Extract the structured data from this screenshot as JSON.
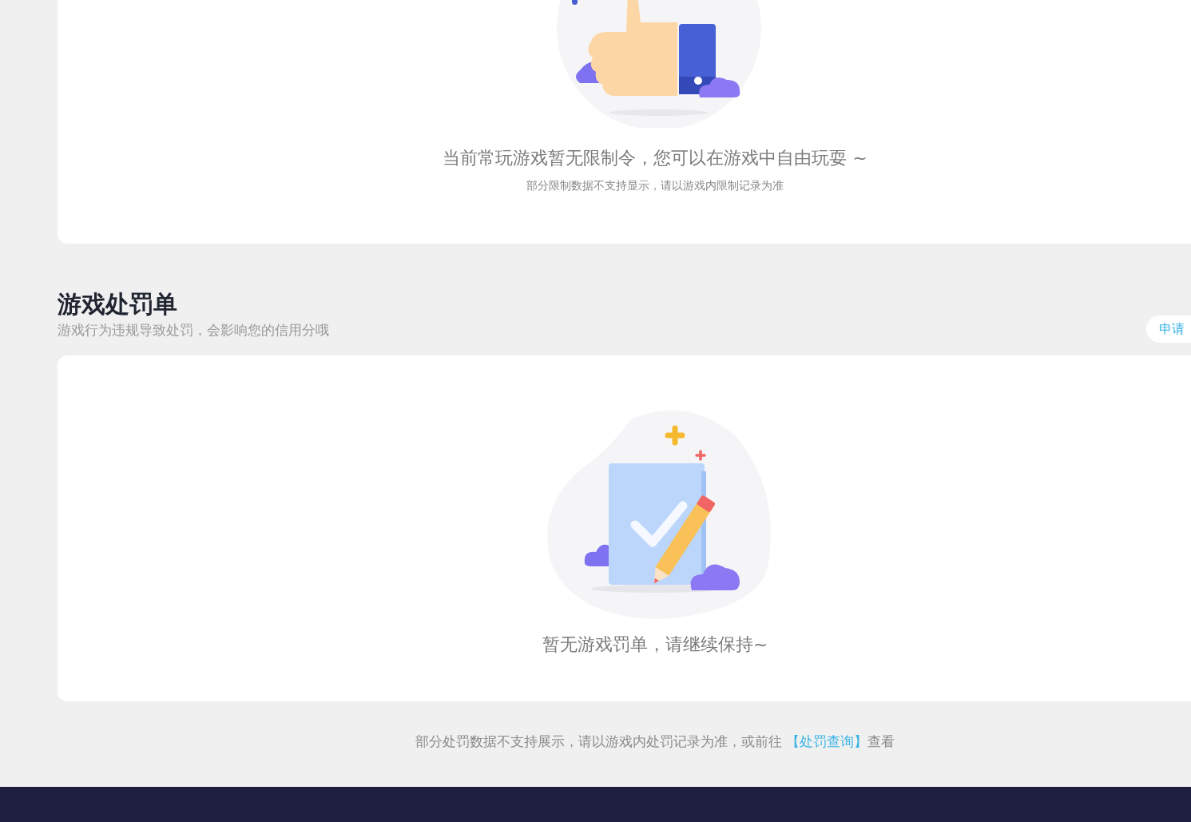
{
  "restriction_card": {
    "message": "当前常玩游戏暂无限制令，您可以在游戏中自由玩耍 ~",
    "note": "部分限制数据不支持显示，请以游戏内限制记录为准"
  },
  "penalty_section": {
    "title": "游戏处罚单",
    "subtitle": "游戏行为违规导致处罚，会影响您的信用分哦",
    "action_button": "申请"
  },
  "penalty_card": {
    "message": "暂无游戏罚单，请继续保持~"
  },
  "footer_note": {
    "parts": [
      {
        "kind": "text",
        "text": "部分处罚数据不支持展示，请以游戏内处罚记录为准，或前往 "
      },
      {
        "kind": "link",
        "text": "【处罚查询】"
      },
      {
        "kind": "text",
        "text": "查看"
      }
    ]
  }
}
